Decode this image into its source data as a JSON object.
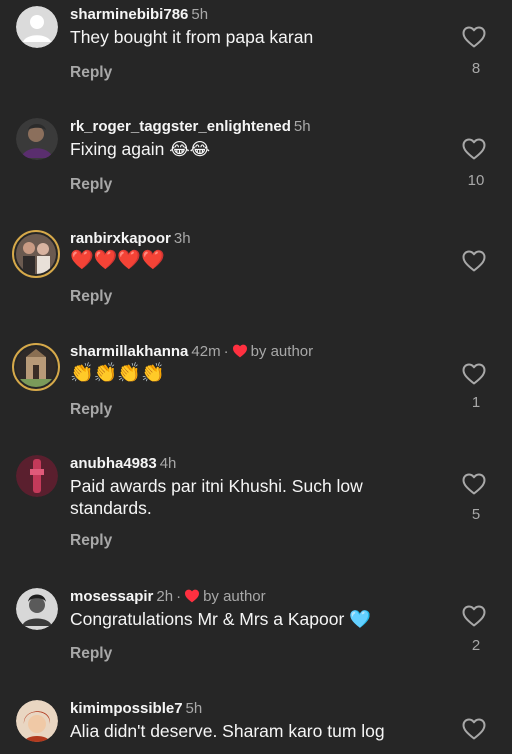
{
  "comments": [
    {
      "username": "sharminebibi786",
      "time": "5h",
      "text": "They bought it from papa karan",
      "reply_label": "Reply",
      "likes": "8"
    },
    {
      "username": "rk_roger_taggster_enlightened",
      "time": "5h",
      "text": "Fixing again 😂😂",
      "reply_label": "Reply",
      "likes": "10"
    },
    {
      "username": "ranbirxkapoor",
      "time": "3h",
      "text": "❤️❤️❤️❤️",
      "reply_label": "Reply",
      "likes": ""
    },
    {
      "username": "sharmillakhanna",
      "time": "42m",
      "separator": "·",
      "author_badge": "by author",
      "text": "👏👏👏👏",
      "reply_label": "Reply",
      "likes": "1"
    },
    {
      "username": "anubha4983",
      "time": "4h",
      "text": "Paid awards par itni Khushi. Such low standards.",
      "reply_label": "Reply",
      "likes": "5"
    },
    {
      "username": "mosessapir",
      "time": "2h",
      "separator": "·",
      "author_badge": "by author",
      "text": "Congratulations Mr & Mrs a Kapoor 🩵",
      "reply_label": "Reply",
      "likes": "2"
    },
    {
      "username": "kimimpossible7",
      "time": "5h",
      "text": "Alia didn't deserve. Sharam karo tum log",
      "reply_label": "",
      "likes": ""
    }
  ],
  "colors": {
    "background": "#262626",
    "text": "#f5f5f5",
    "muted": "#a8a8a8",
    "author_heart": "#ff3040"
  },
  "icons": {
    "like": "heart-outline-icon",
    "author_like": "heart-filled-icon"
  }
}
